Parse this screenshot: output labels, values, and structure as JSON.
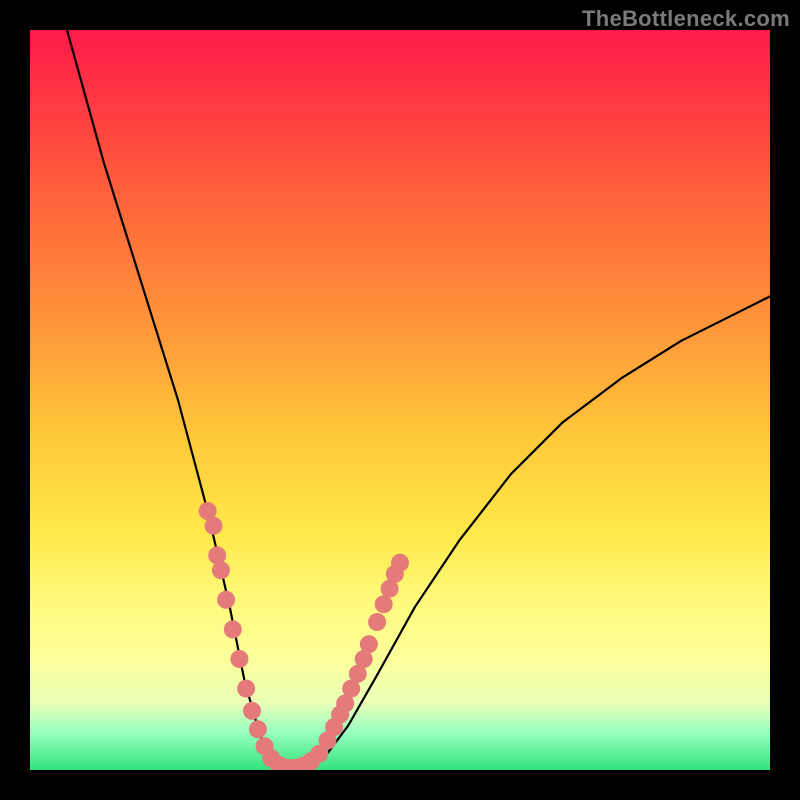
{
  "attribution": "TheBottleneck.com",
  "chart_data": {
    "type": "line",
    "title": "",
    "xlabel": "",
    "ylabel": "",
    "xlim": [
      0,
      100
    ],
    "ylim": [
      0,
      100
    ],
    "series": [
      {
        "name": "bottleneck-curve",
        "x": [
          5,
          10,
          15,
          20,
          24,
          27,
          29,
          31,
          32.5,
          34,
          36,
          38,
          40,
          43,
          47,
          52,
          58,
          65,
          72,
          80,
          88,
          96,
          100
        ],
        "y": [
          100,
          82,
          66,
          50,
          35,
          22,
          12,
          5,
          1,
          0,
          0,
          0.5,
          2,
          6,
          13,
          22,
          31,
          40,
          47,
          53,
          58,
          62,
          64
        ]
      }
    ],
    "overlay_points_left": [
      {
        "x": 24.0,
        "y": 35
      },
      {
        "x": 24.8,
        "y": 33
      },
      {
        "x": 25.3,
        "y": 29
      },
      {
        "x": 25.8,
        "y": 27
      },
      {
        "x": 26.5,
        "y": 23
      },
      {
        "x": 27.4,
        "y": 19
      },
      {
        "x": 28.3,
        "y": 15
      },
      {
        "x": 29.2,
        "y": 11
      },
      {
        "x": 30.0,
        "y": 8
      },
      {
        "x": 30.8,
        "y": 5.5
      }
    ],
    "overlay_points_bottom": [
      {
        "x": 31.7,
        "y": 3.2
      },
      {
        "x": 32.6,
        "y": 1.6
      },
      {
        "x": 33.6,
        "y": 0.7
      },
      {
        "x": 34.7,
        "y": 0.3
      },
      {
        "x": 35.8,
        "y": 0.3
      },
      {
        "x": 36.9,
        "y": 0.6
      },
      {
        "x": 38.0,
        "y": 1.2
      },
      {
        "x": 39.1,
        "y": 2.2
      }
    ],
    "overlay_points_right": [
      {
        "x": 40.2,
        "y": 4.0
      },
      {
        "x": 41.1,
        "y": 5.8
      },
      {
        "x": 41.9,
        "y": 7.5
      },
      {
        "x": 42.6,
        "y": 9.0
      },
      {
        "x": 43.4,
        "y": 11.0
      },
      {
        "x": 44.3,
        "y": 13.0
      },
      {
        "x": 45.1,
        "y": 15.0
      },
      {
        "x": 45.8,
        "y": 17.0
      },
      {
        "x": 46.9,
        "y": 20.0
      },
      {
        "x": 47.8,
        "y": 22.4
      },
      {
        "x": 48.6,
        "y": 24.5
      },
      {
        "x": 49.3,
        "y": 26.5
      },
      {
        "x": 50.0,
        "y": 28.0
      }
    ],
    "colors": {
      "curve": "#000000",
      "dot": "#e57a7a"
    }
  }
}
